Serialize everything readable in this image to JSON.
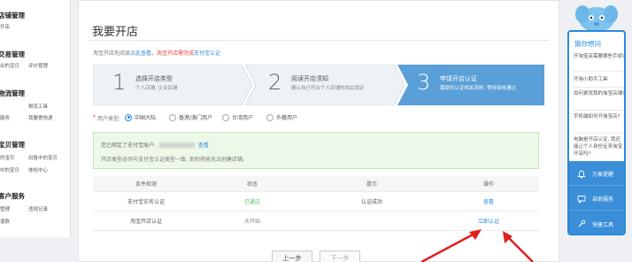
{
  "sidebar": {
    "groups": [
      {
        "title": "店铺管理",
        "links": [
          "开店"
        ]
      },
      {
        "title": "交易管理",
        "links": [
          "出的宝贝",
          "评价管理"
        ]
      },
      {
        "title": "物流管理",
        "links": [
          "物流工具",
          "服务",
          "我要寄快递"
        ]
      },
      {
        "title": "宝贝管理",
        "links": [
          "的宝贝",
          "出售中的宝贝",
          "中的宝贝",
          "体检中心"
        ]
      },
      {
        "title": "客户服务",
        "links": [
          "管理",
          "违规记录",
          "退款"
        ]
      }
    ]
  },
  "main": {
    "title": "我要开店",
    "notice": {
      "part1": "淘宝开店先阅读",
      "part2": "点此查看",
      "part3": "。淘宝开店需完成",
      "part4": "支付宝认证"
    },
    "steps": [
      {
        "num": "1",
        "title": "选择开店类型",
        "sub": "个人店铺, 企业店铺"
      },
      {
        "num": "2",
        "title": "阅读开店须知",
        "sub": "确认自己符合个人店铺的相关规定"
      },
      {
        "num": "3",
        "title": "申请开店认证",
        "sub": "需提供认证相关资料, 等待审核通过"
      }
    ],
    "user_type": {
      "label": "用户类型:",
      "options": [
        "中国大陆",
        "香港/澳门用户",
        "台湾用户",
        "外籍用户"
      ],
      "selected": "中国大陆"
    },
    "info": {
      "bound_label": "您已绑定了支付宝账户:",
      "view_link": "查看",
      "note": "开店类型必须与支付宝认证类型一致, 否则将能无法创建店铺。"
    },
    "table": {
      "headers": [
        "条件检测",
        "状态",
        "提示",
        "操作"
      ],
      "rows": [
        {
          "item": "支付宝实名认证",
          "status": "已通过",
          "tip": "认证成功",
          "action": "查看"
        },
        {
          "item": "淘宝开店认证",
          "status": "未开始",
          "tip": "",
          "action": "立即认证"
        }
      ]
    },
    "buttons": {
      "prev": "上一步",
      "next": "下一步"
    }
  },
  "help_panel": {
    "title": "猜你想问",
    "questions": [
      "开淘宝店需要哪些手续?",
      "开淘小助手工具",
      "如何更改我的淘宝店铺?",
      "手机端如何开淘宝店?",
      "电脑是开店认证, 我还能让个人身份证来淘宝开店吗?"
    ],
    "actions": [
      "万象提醒",
      "自助服务",
      "快捷工具"
    ]
  },
  "colors": {
    "accent": "#2a8adb",
    "step_active": "#5a9fd8",
    "step_inactive": "#e9edf2",
    "success": "#5cb85c",
    "alert": "#e4393c"
  }
}
